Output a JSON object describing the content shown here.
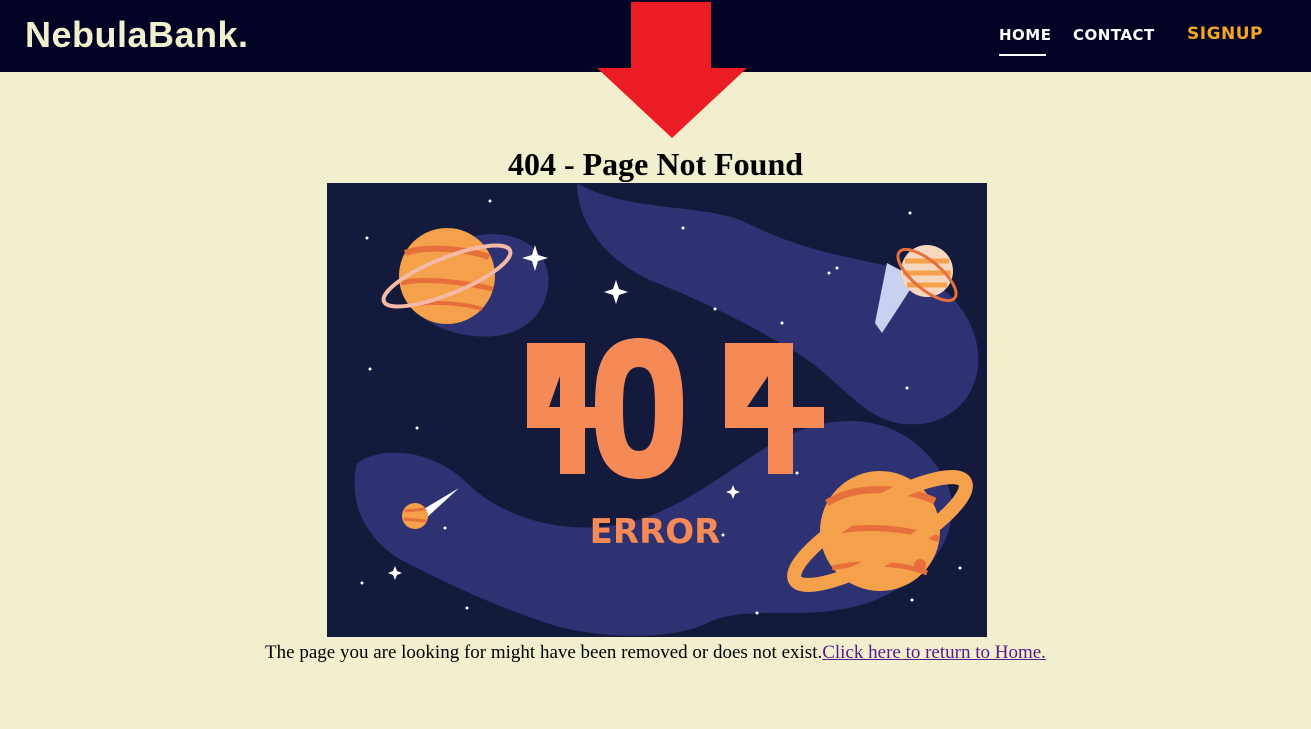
{
  "navbar": {
    "brand": "NebulaBank.",
    "links": [
      {
        "label": "HOME"
      },
      {
        "label": "CONTACT"
      },
      {
        "label": "SIGNUP"
      }
    ]
  },
  "main": {
    "title": "404 - Page Not Found",
    "image": {
      "big_text": "404",
      "sub_text": "ERROR"
    },
    "message": "The page you are looking for might have been removed or does not exist.",
    "home_link": "Click here to return to Home."
  },
  "colors": {
    "navbar_bg": "#020224",
    "page_bg": "#f2efcf",
    "signup": "#f5a623",
    "arrow": "#ec1c24",
    "image_bg": "#141a3c",
    "error_orange": "#f58a57"
  }
}
